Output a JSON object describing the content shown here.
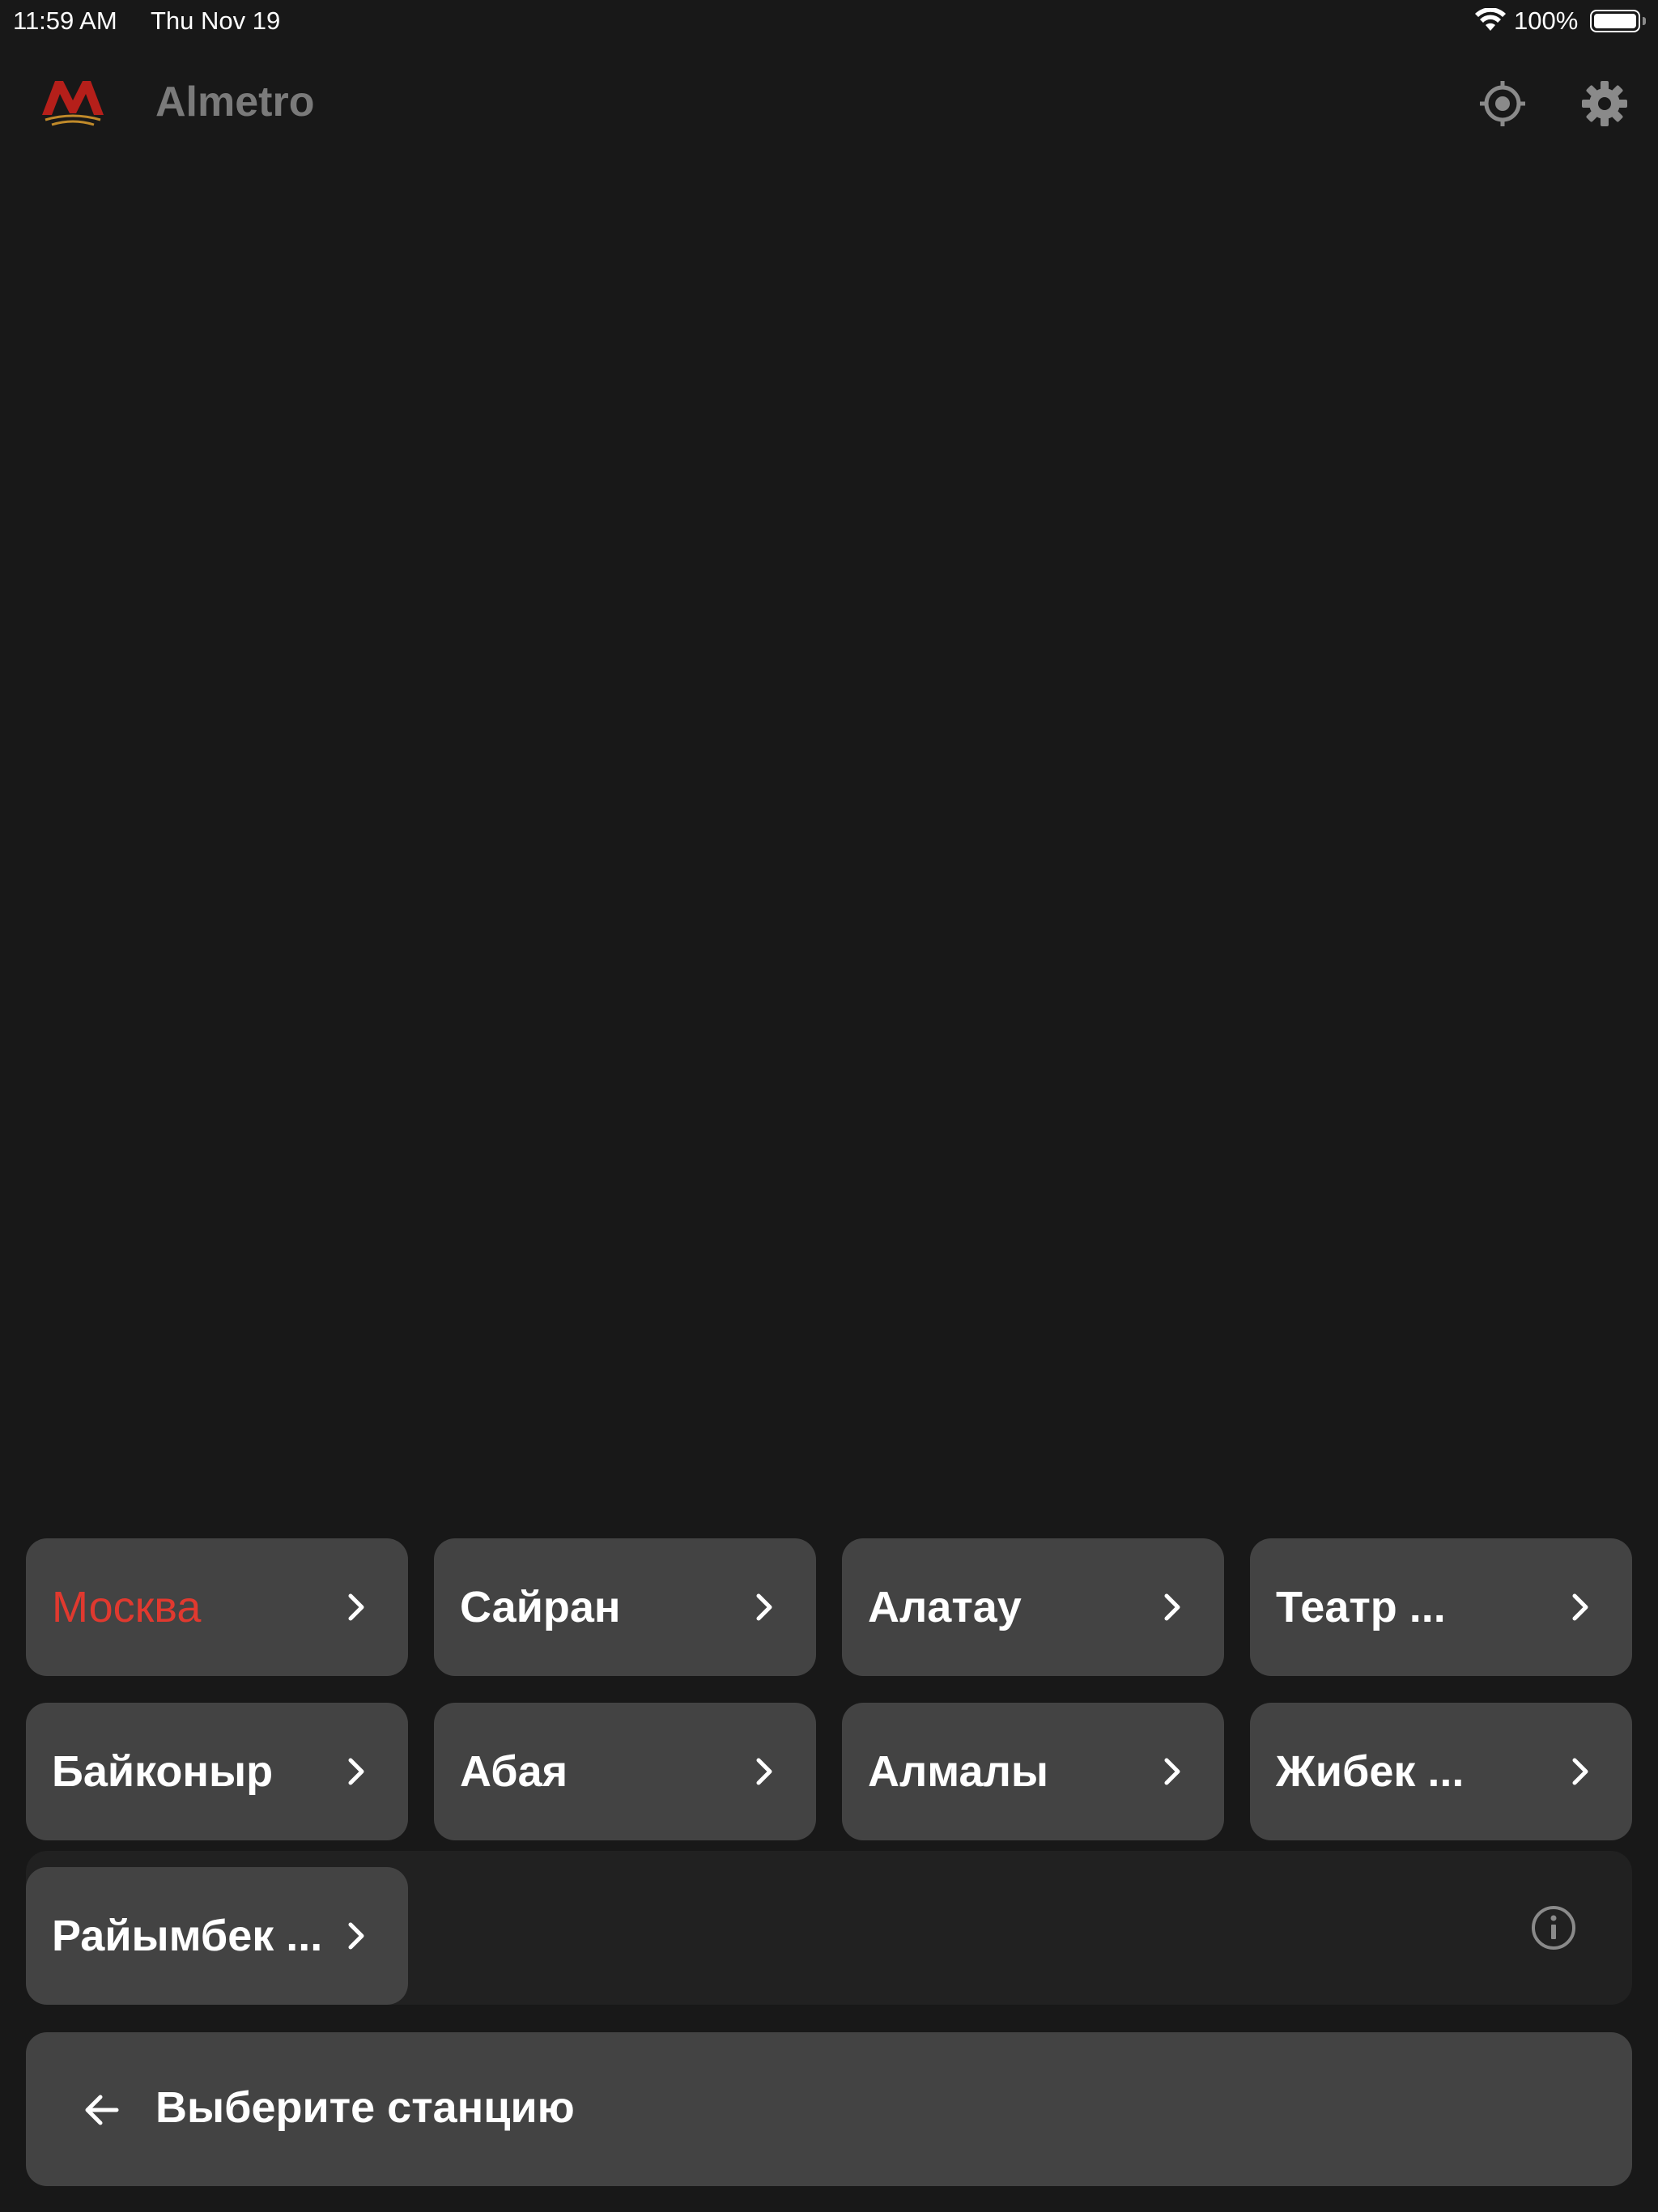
{
  "status_bar": {
    "time": "11:59 AM",
    "date": "Thu Nov 19",
    "battery": "100%",
    "battery_level": 1.0
  },
  "header": {
    "title": "Almetro",
    "logo_icon": "metro-m-logo",
    "locate_icon": "crosshair-icon",
    "settings_icon": "gear-icon"
  },
  "stations": [
    {
      "label": "Москва",
      "active": true
    },
    {
      "label": "Сайран",
      "active": false
    },
    {
      "label": "Алатау",
      "active": false
    },
    {
      "label": "Театр ...",
      "active": false
    },
    {
      "label": "Байконыр",
      "active": false
    },
    {
      "label": "Абая",
      "active": false
    },
    {
      "label": "Алмалы",
      "active": false
    },
    {
      "label": "Жибек ...",
      "active": false
    },
    {
      "label": "Райымбек ...",
      "active": false
    }
  ],
  "info": {
    "icon": "info-icon"
  },
  "select_bar": {
    "label": "Выберите станцию",
    "icon": "arrow-left-icon"
  },
  "colors": {
    "background": "#181818",
    "tile": "#434343",
    "accent_red": "#e0392f",
    "muted_text": "#7a7a7a"
  }
}
